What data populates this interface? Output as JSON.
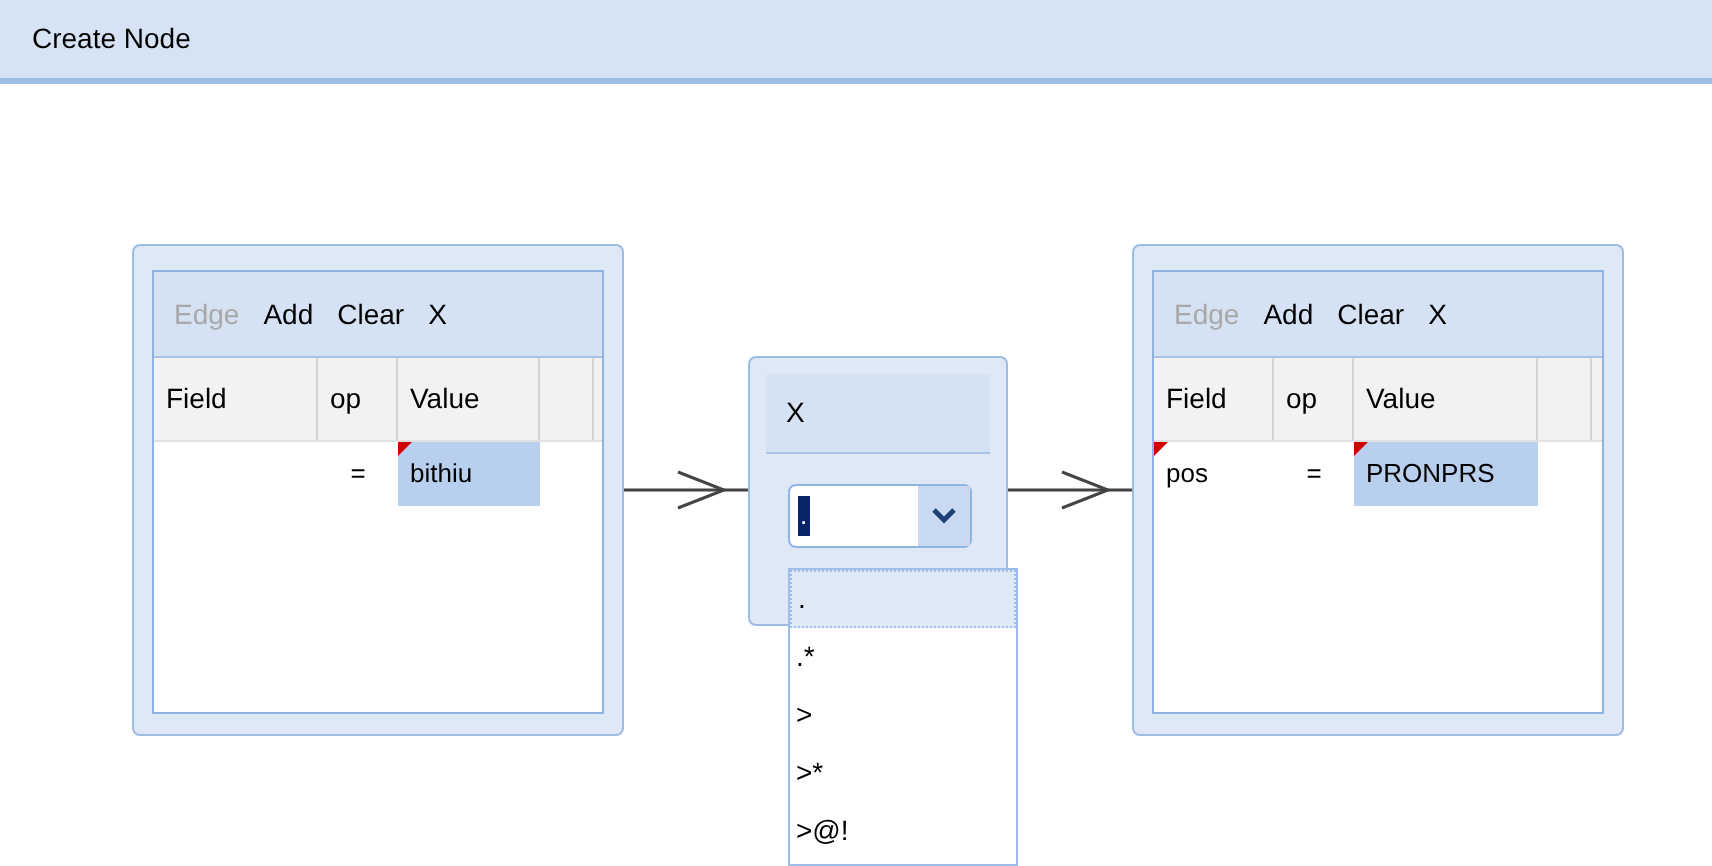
{
  "title": "Create Node",
  "nodes": [
    {
      "toolbar": [
        {
          "label": "Edge",
          "disabled": true
        },
        {
          "label": "Add",
          "disabled": false
        },
        {
          "label": "Clear",
          "disabled": false
        },
        {
          "label": "X",
          "disabled": false
        }
      ],
      "columns": [
        "Field",
        "op",
        "Value"
      ],
      "rows": [
        {
          "cells": [
            {
              "text": "",
              "flagged": false,
              "selected": false
            },
            {
              "text": "=",
              "flagged": false,
              "selected": false
            },
            {
              "text": "bithiu",
              "flagged": true,
              "selected": true
            }
          ]
        }
      ]
    },
    {
      "toolbar": [
        {
          "label": "Edge",
          "disabled": true
        },
        {
          "label": "Add",
          "disabled": false
        },
        {
          "label": "Clear",
          "disabled": false
        },
        {
          "label": "X",
          "disabled": false
        }
      ],
      "columns": [
        "Field",
        "op",
        "Value"
      ],
      "rows": [
        {
          "cells": [
            {
              "text": "pos",
              "flagged": true,
              "selected": false
            },
            {
              "text": "=",
              "flagged": false,
              "selected": false
            },
            {
              "text": "PRONPRS",
              "flagged": true,
              "selected": true
            }
          ]
        }
      ]
    }
  ],
  "edge": {
    "close": "X",
    "value": ".",
    "options": [
      {
        "label": ".",
        "selected": true
      },
      {
        "label": ".*",
        "selected": false
      },
      {
        "label": ">",
        "selected": false
      },
      {
        "label": ">*",
        "selected": false
      },
      {
        "label": ">@!",
        "selected": false
      }
    ]
  }
}
